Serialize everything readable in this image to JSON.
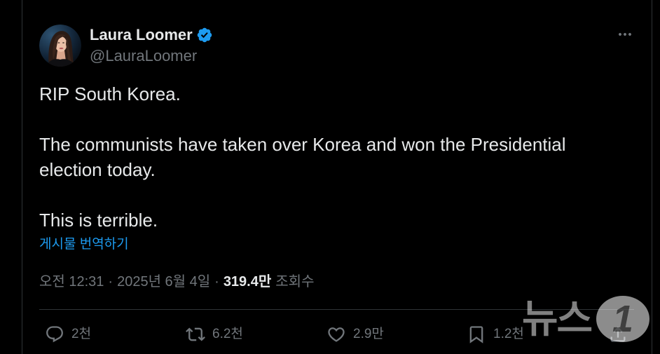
{
  "theme": {
    "background": "#000000",
    "text": "#e7e9ea",
    "secondary_text": "#71767b",
    "accent": "#1d9bf0",
    "border": "#2f3336"
  },
  "post": {
    "author": {
      "name": "Laura Loomer",
      "handle": "@LauraLoomer",
      "verified": true,
      "verified_icon": "verified-badge-icon"
    },
    "more_icon": "more-icon",
    "text": "RIP South Korea.\n\nThe communists have taken over Korea and won the Presidential election today.\n\nThis is terrible.",
    "translate_label": "게시물 번역하기",
    "meta": {
      "time": "오전 12:31",
      "separator": "·",
      "date": "2025년 6월 4일",
      "views_count": "319.4만",
      "views_label": "조회수"
    },
    "actions": [
      {
        "icon": "reply-icon",
        "count": "2천"
      },
      {
        "icon": "repost-icon",
        "count": "6.2천"
      },
      {
        "icon": "heart-icon",
        "count": "2.9만"
      },
      {
        "icon": "bookmark-icon",
        "count": "1.2천"
      },
      {
        "icon": "share-icon"
      }
    ]
  },
  "watermark": {
    "text": "뉴스",
    "badge": "1"
  }
}
